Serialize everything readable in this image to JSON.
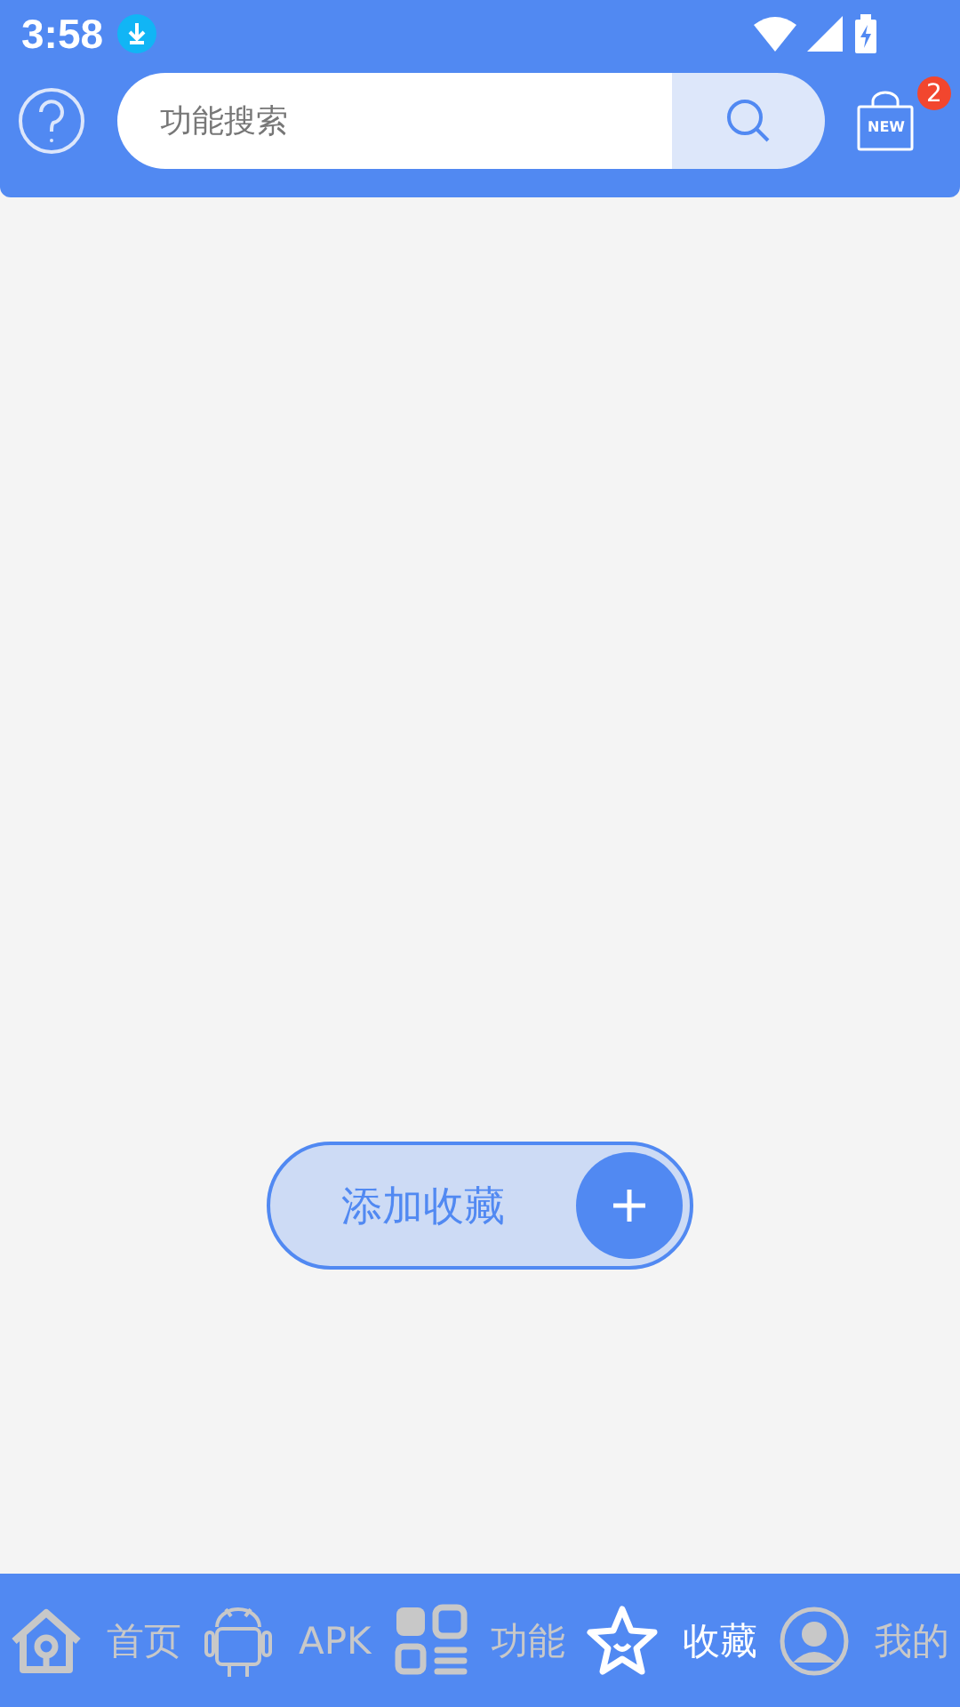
{
  "status_bar": {
    "time": "3:58"
  },
  "header": {
    "search": {
      "placeholder": "功能搜索"
    },
    "new_badge": "NEW",
    "badge_count": "2"
  },
  "empty_state": {
    "button": "添加收藏"
  },
  "bottom_nav": [
    {
      "label": "首页",
      "kind": "home",
      "selected": false
    },
    {
      "label": "APK",
      "kind": "apk",
      "selected": false
    },
    {
      "label": "功能",
      "kind": "grid",
      "selected": false
    },
    {
      "label": "收藏",
      "kind": "star",
      "selected": true
    },
    {
      "label": "我的",
      "kind": "profile",
      "selected": false
    }
  ]
}
